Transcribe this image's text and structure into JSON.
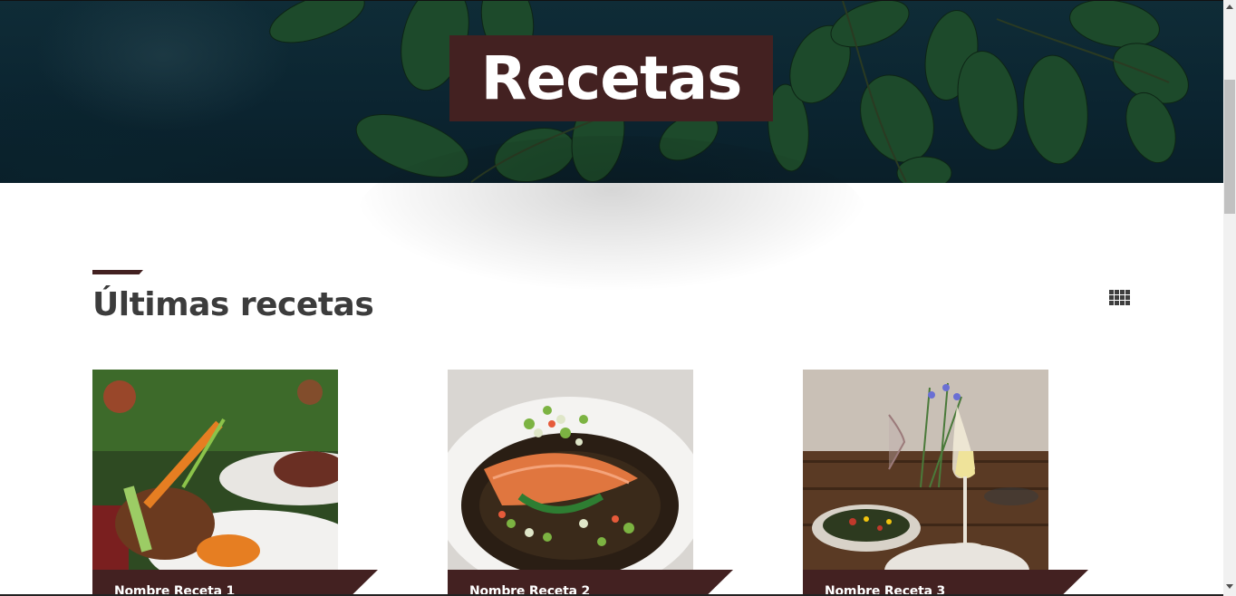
{
  "hero": {
    "title": "Recetas"
  },
  "section": {
    "title": "Últimas recetas",
    "view_toggle_icon": "grid-icon"
  },
  "recipes": [
    {
      "name": "Nombre Receta 1"
    },
    {
      "name": "Nombre Receta 2"
    },
    {
      "name": "Nombre Receta 3"
    }
  ],
  "colors": {
    "accent": "#432121",
    "heading": "#3c3c3c",
    "hero_bg": "#0f2c37",
    "leaf": "#1f4a2a"
  }
}
